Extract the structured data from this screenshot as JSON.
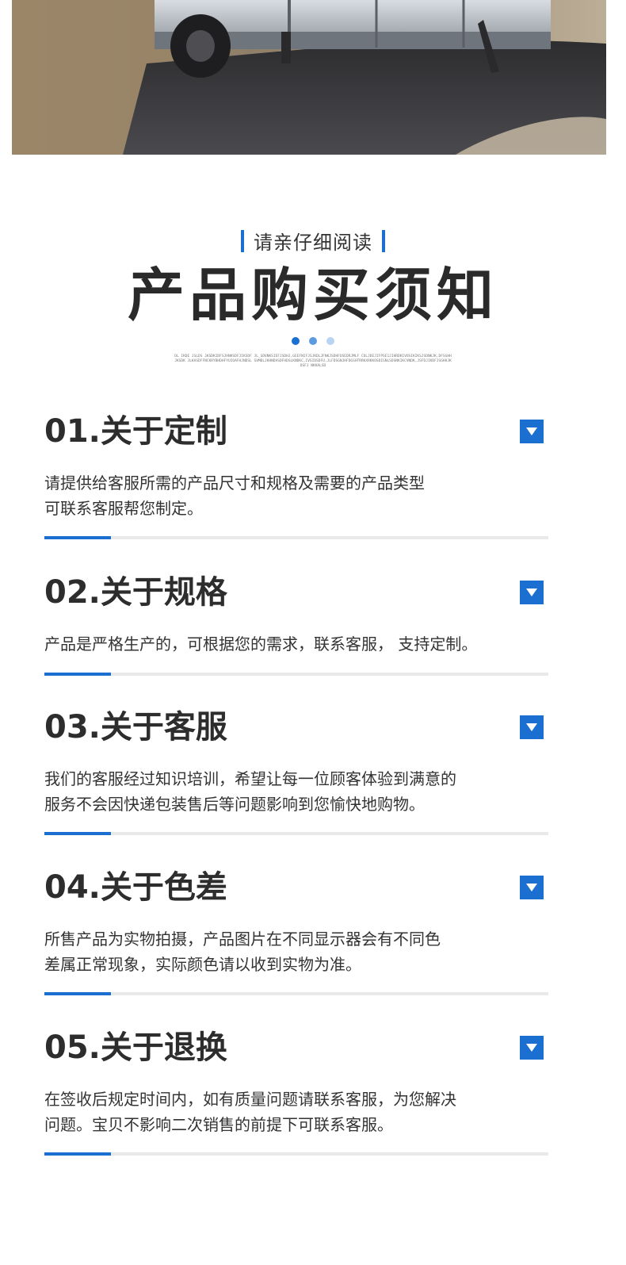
{
  "header": {
    "subtitle": "请亲仔细阅读",
    "title": "产品购买须知",
    "fine_print": "DL IKDE JSLDS JKSDKIDFSJHNKSDFJIKSDF JL_SDVNKSIEFJSDHJ,GEEFNIFJSJKDLJFNKJSDHFOSEDRJMLF COLJDEJIFPSE1JIHRDKIVOSIKIKSJSDNKJK,DFSGHHJKSDK JLKASDFFNCKRYBHDHFYUIOAFHJNDSL SVMDLJKHNDASDFHDSLKNDKC,IVSIDSDFU,JLFDSGNJHFDGSHTRRKXRKKOSDIGNLSDSNKIKCVNDK,JSFDJIKDFJSGHHJKDSFJ NKKALSD"
  },
  "sections": [
    {
      "number_title": "01.关于定制",
      "lines": [
        "请提供给客服所需的产品尺寸和规格及需要的产品类型",
        "可联系客服帮您制定。"
      ]
    },
    {
      "number_title": "02.关于规格",
      "lines": [
        "产品是严格生产的，可根据您的需求，联系客服，  支持定制。"
      ]
    },
    {
      "number_title": "03.关于客服",
      "lines": [
        "我们的客服经过知识培训，希望让每一位顾客体验到满意的",
        "服务不会因快递包装售后等问题影响到您愉快地购物。"
      ]
    },
    {
      "number_title": "04.关于色差",
      "lines": [
        "所售产品为实物拍摄，产品图片在不同显示器会有不同色",
        "差属正常现象，实际颜色请以收到实物为准。"
      ]
    },
    {
      "number_title": "05.关于退换",
      "lines": [
        "在签收后规定时间内，如有质量问题请联系客服，为您解决",
        "问题。宝贝不影响二次销售的前提下可联系客服。"
      ]
    }
  ],
  "colors": {
    "accent": "#1b6fd0",
    "text": "#333333",
    "divider": "#e9e9e9"
  }
}
